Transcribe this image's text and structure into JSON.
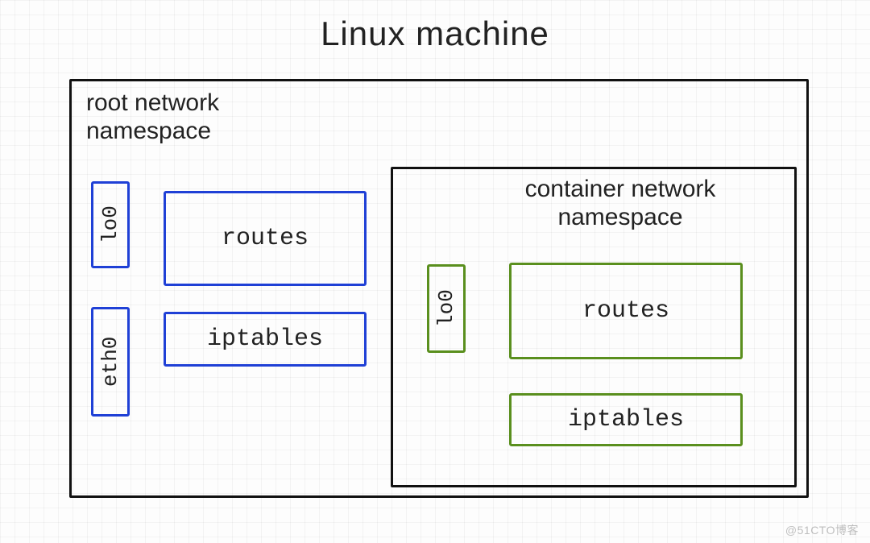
{
  "title": "Linux machine",
  "root_namespace": {
    "label": "root network\nnamespace",
    "interfaces": {
      "lo": "lo0",
      "eth": "eth0"
    },
    "routes_label": "routes",
    "iptables_label": "iptables"
  },
  "container_namespace": {
    "label": "container network\nnamespace",
    "interfaces": {
      "lo": "lo0"
    },
    "routes_label": "routes",
    "iptables_label": "iptables"
  },
  "watermark": "@51CTO博客",
  "colors": {
    "root_box": "#1f40d6",
    "container_box": "#5a8f1e",
    "outline": "#111"
  }
}
